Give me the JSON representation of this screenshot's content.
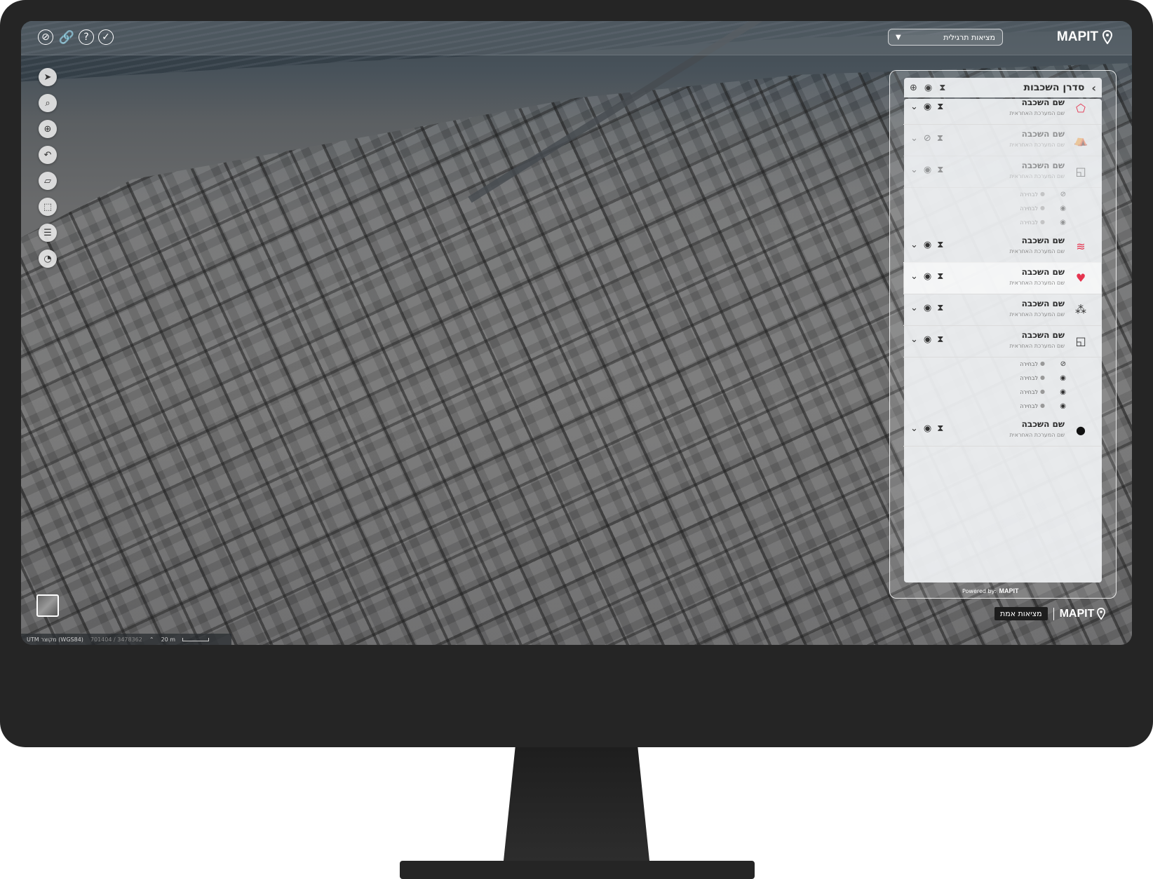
{
  "topbar": {
    "scenario_label": "מציאות תרגילית",
    "logo_text": "MAPIT",
    "icons": [
      "satellite-off-icon",
      "link-icon",
      "help-icon",
      "check-circle-icon"
    ]
  },
  "left_toolbar": {
    "icons": [
      "compass-icon",
      "search-icon",
      "crosshair-icon",
      "undo-icon",
      "ruler-icon",
      "area-select-icon",
      "list-icon",
      "layers-gauge-icon"
    ]
  },
  "statusbar": {
    "projection": "UTM מקוצר (WGS84)",
    "coords": "701404 / 3478362",
    "scale": "20 m"
  },
  "layers_panel": {
    "title": "סדרן השכבות",
    "layers": [
      {
        "name": "שם השכבה",
        "sub": "שם המערכת האחראית",
        "icon": "polygon-icon",
        "icon_color": "#e5344f",
        "dim": false
      },
      {
        "name": "שם השכבה",
        "sub": "שם המערכת האחראית",
        "icon": "tent-icon",
        "icon_color": "#555555",
        "dim": true
      },
      {
        "name": "שם השכבה",
        "sub": "שם המערכת האחראית",
        "icon": "square-icon",
        "icon_color": "#333333",
        "dim": true
      },
      {
        "name": "שם השכבה",
        "sub": "שם המערכת האחראית",
        "icon": "wave-icon",
        "icon_color": "#e5344f",
        "dim": false
      },
      {
        "name": "שם השכבה",
        "sub": "שם המערכת האחראית",
        "icon": "heart-icon",
        "icon_color": "#e5344f",
        "dim": false
      },
      {
        "name": "שם השכבה",
        "sub": "שם המערכת האחראית",
        "icon": "circles-icon",
        "icon_color": "#333333",
        "dim": false
      },
      {
        "name": "שם השכבה",
        "sub": "שם המערכת האחראית",
        "icon": "square-icon",
        "icon_color": "#333333",
        "dim": false
      },
      {
        "name": "שם השכבה",
        "sub": "שם המערכת האחראית",
        "icon": "circle-icon",
        "icon_color": "#111111",
        "dim": false
      }
    ],
    "sub_item_label": "לבחירה",
    "powered_by": "Powered by:",
    "powered_logo": "MAPIT"
  },
  "footer": {
    "reality_badge": "מציאות אמת",
    "logo_text": "MAPIT"
  },
  "colors": {
    "accent": "#e5344f",
    "monitor": "#252525"
  }
}
